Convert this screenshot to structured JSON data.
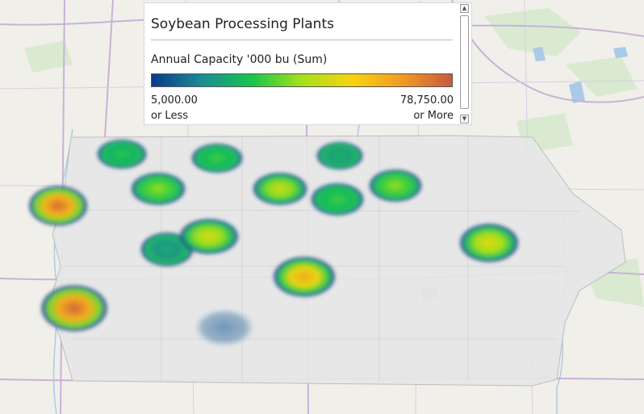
{
  "legend": {
    "title": "Soybean Processing Plants",
    "subtitle": "Annual Capacity '000 bu (Sum)",
    "min_value": "5,000.00",
    "min_suffix": "or Less",
    "max_value": "78,750.00",
    "max_suffix": "or More",
    "gradient_colors": [
      "#0a3a8a",
      "#1d8b93",
      "#16c64d",
      "#a6e01a",
      "#f7d40f",
      "#f29a24",
      "#c8593c"
    ],
    "scroll_up_icon": "chevron-up-icon",
    "scroll_down_icon": "chevron-down-icon"
  },
  "map": {
    "region_fill": "#e6e6e6",
    "heat_points": [
      {
        "id": "nw-1",
        "intensity": 0.35
      },
      {
        "id": "n-2",
        "intensity": 0.38
      },
      {
        "id": "n-3",
        "intensity": 0.28
      },
      {
        "id": "nw-4",
        "intensity": 0.48
      },
      {
        "id": "n-5",
        "intensity": 0.58
      },
      {
        "id": "n-6",
        "intensity": 0.38
      },
      {
        "id": "ne-7",
        "intensity": 0.48
      },
      {
        "id": "w-8",
        "intensity": 0.95
      },
      {
        "id": "c-9",
        "intensity": 0.25
      },
      {
        "id": "c-10",
        "intensity": 0.6
      },
      {
        "id": "e-11",
        "intensity": 0.62
      },
      {
        "id": "c-12",
        "intensity": 0.78
      },
      {
        "id": "sw-13",
        "intensity": 0.97
      },
      {
        "id": "s-14",
        "intensity": 0.1
      }
    ]
  }
}
